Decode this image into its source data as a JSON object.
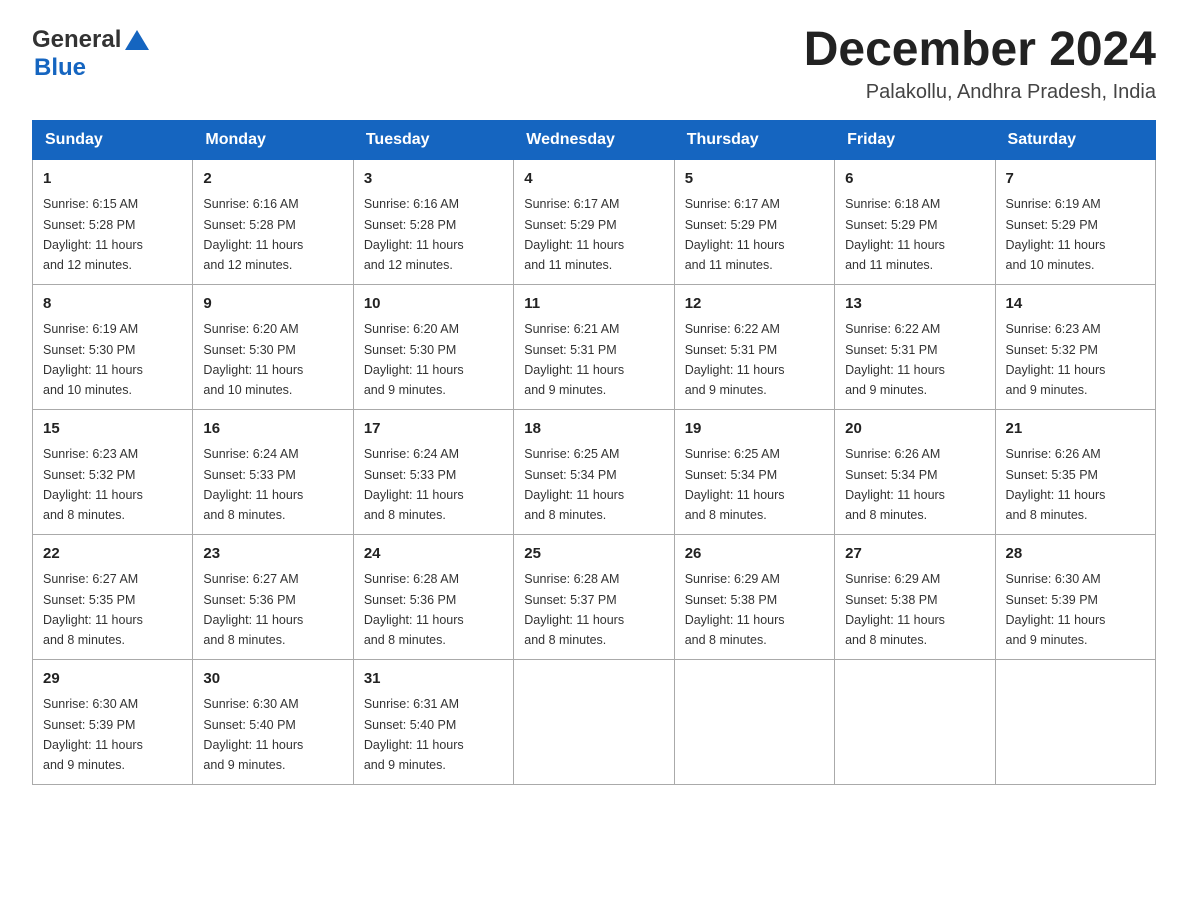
{
  "header": {
    "logo_general": "General",
    "logo_blue": "Blue",
    "month_title": "December 2024",
    "location": "Palakollu, Andhra Pradesh, India"
  },
  "columns": [
    "Sunday",
    "Monday",
    "Tuesday",
    "Wednesday",
    "Thursday",
    "Friday",
    "Saturday"
  ],
  "weeks": [
    [
      {
        "day": "1",
        "sunrise": "6:15 AM",
        "sunset": "5:28 PM",
        "daylight": "11 hours and 12 minutes."
      },
      {
        "day": "2",
        "sunrise": "6:16 AM",
        "sunset": "5:28 PM",
        "daylight": "11 hours and 12 minutes."
      },
      {
        "day": "3",
        "sunrise": "6:16 AM",
        "sunset": "5:28 PM",
        "daylight": "11 hours and 12 minutes."
      },
      {
        "day": "4",
        "sunrise": "6:17 AM",
        "sunset": "5:29 PM",
        "daylight": "11 hours and 11 minutes."
      },
      {
        "day": "5",
        "sunrise": "6:17 AM",
        "sunset": "5:29 PM",
        "daylight": "11 hours and 11 minutes."
      },
      {
        "day": "6",
        "sunrise": "6:18 AM",
        "sunset": "5:29 PM",
        "daylight": "11 hours and 11 minutes."
      },
      {
        "day": "7",
        "sunrise": "6:19 AM",
        "sunset": "5:29 PM",
        "daylight": "11 hours and 10 minutes."
      }
    ],
    [
      {
        "day": "8",
        "sunrise": "6:19 AM",
        "sunset": "5:30 PM",
        "daylight": "11 hours and 10 minutes."
      },
      {
        "day": "9",
        "sunrise": "6:20 AM",
        "sunset": "5:30 PM",
        "daylight": "11 hours and 10 minutes."
      },
      {
        "day": "10",
        "sunrise": "6:20 AM",
        "sunset": "5:30 PM",
        "daylight": "11 hours and 9 minutes."
      },
      {
        "day": "11",
        "sunrise": "6:21 AM",
        "sunset": "5:31 PM",
        "daylight": "11 hours and 9 minutes."
      },
      {
        "day": "12",
        "sunrise": "6:22 AM",
        "sunset": "5:31 PM",
        "daylight": "11 hours and 9 minutes."
      },
      {
        "day": "13",
        "sunrise": "6:22 AM",
        "sunset": "5:31 PM",
        "daylight": "11 hours and 9 minutes."
      },
      {
        "day": "14",
        "sunrise": "6:23 AM",
        "sunset": "5:32 PM",
        "daylight": "11 hours and 9 minutes."
      }
    ],
    [
      {
        "day": "15",
        "sunrise": "6:23 AM",
        "sunset": "5:32 PM",
        "daylight": "11 hours and 8 minutes."
      },
      {
        "day": "16",
        "sunrise": "6:24 AM",
        "sunset": "5:33 PM",
        "daylight": "11 hours and 8 minutes."
      },
      {
        "day": "17",
        "sunrise": "6:24 AM",
        "sunset": "5:33 PM",
        "daylight": "11 hours and 8 minutes."
      },
      {
        "day": "18",
        "sunrise": "6:25 AM",
        "sunset": "5:34 PM",
        "daylight": "11 hours and 8 minutes."
      },
      {
        "day": "19",
        "sunrise": "6:25 AM",
        "sunset": "5:34 PM",
        "daylight": "11 hours and 8 minutes."
      },
      {
        "day": "20",
        "sunrise": "6:26 AM",
        "sunset": "5:34 PM",
        "daylight": "11 hours and 8 minutes."
      },
      {
        "day": "21",
        "sunrise": "6:26 AM",
        "sunset": "5:35 PM",
        "daylight": "11 hours and 8 minutes."
      }
    ],
    [
      {
        "day": "22",
        "sunrise": "6:27 AM",
        "sunset": "5:35 PM",
        "daylight": "11 hours and 8 minutes."
      },
      {
        "day": "23",
        "sunrise": "6:27 AM",
        "sunset": "5:36 PM",
        "daylight": "11 hours and 8 minutes."
      },
      {
        "day": "24",
        "sunrise": "6:28 AM",
        "sunset": "5:36 PM",
        "daylight": "11 hours and 8 minutes."
      },
      {
        "day": "25",
        "sunrise": "6:28 AM",
        "sunset": "5:37 PM",
        "daylight": "11 hours and 8 minutes."
      },
      {
        "day": "26",
        "sunrise": "6:29 AM",
        "sunset": "5:38 PM",
        "daylight": "11 hours and 8 minutes."
      },
      {
        "day": "27",
        "sunrise": "6:29 AM",
        "sunset": "5:38 PM",
        "daylight": "11 hours and 8 minutes."
      },
      {
        "day": "28",
        "sunrise": "6:30 AM",
        "sunset": "5:39 PM",
        "daylight": "11 hours and 9 minutes."
      }
    ],
    [
      {
        "day": "29",
        "sunrise": "6:30 AM",
        "sunset": "5:39 PM",
        "daylight": "11 hours and 9 minutes."
      },
      {
        "day": "30",
        "sunrise": "6:30 AM",
        "sunset": "5:40 PM",
        "daylight": "11 hours and 9 minutes."
      },
      {
        "day": "31",
        "sunrise": "6:31 AM",
        "sunset": "5:40 PM",
        "daylight": "11 hours and 9 minutes."
      },
      null,
      null,
      null,
      null
    ]
  ],
  "labels": {
    "sunrise": "Sunrise:",
    "sunset": "Sunset:",
    "daylight": "Daylight:"
  }
}
